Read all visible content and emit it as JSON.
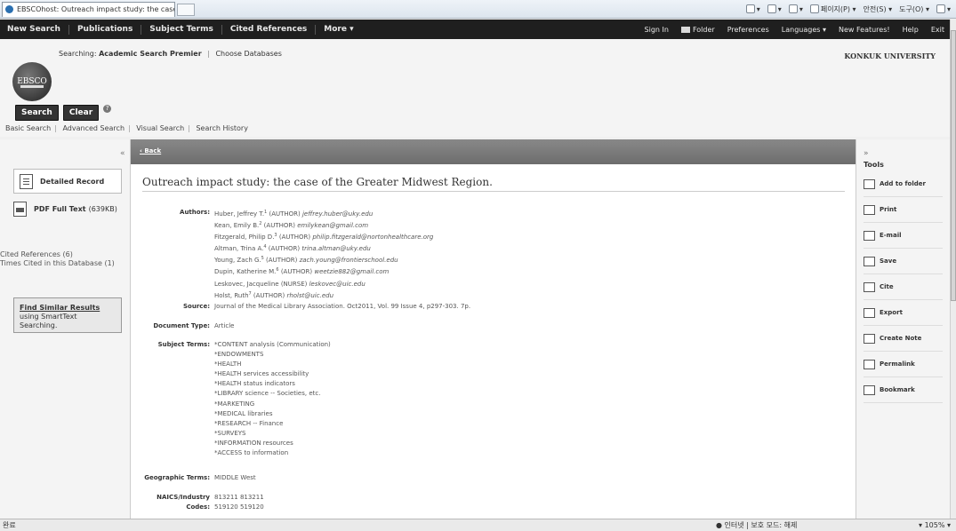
{
  "browser": {
    "tab_title": "EBSCOhost: Outreach impact study: the case of ...",
    "cmd_items": [
      "▾",
      "▾",
      "▾",
      "페이지(P) ▾",
      "안전(S) ▾",
      "도구(O) ▾",
      "▾"
    ],
    "status_left": "완료",
    "status_zone": "인터넷 | 보호 모드: 해제",
    "status_zoom": "105%"
  },
  "topnav": {
    "left": [
      "New Search",
      "Publications",
      "Subject Terms",
      "Cited References",
      "More ▾"
    ],
    "signin": "Sign In",
    "folder": "Folder",
    "preferences": "Preferences",
    "languages": "Languages ▾",
    "new_features": "New Features!",
    "help": "Help",
    "exit": "Exit"
  },
  "search": {
    "logo_text": "EBSCO",
    "searching_label": "Searching:",
    "database": "Academic Search Premier",
    "choose_db": "Choose Databases",
    "university": "KONKUK UNIVERSITY",
    "search_btn": "Search",
    "clear_btn": "Clear",
    "help": "?",
    "links": [
      "Basic Search",
      "Advanced Search",
      "Visual Search",
      "Search History"
    ]
  },
  "left": {
    "collapse": "«",
    "detailed_record": "Detailed Record",
    "pdf_label": "PDF Full Text",
    "pdf_size": "(639KB)",
    "cited_refs": "Cited References (6)",
    "times_cited": "Times Cited in this Database (1)",
    "find_similar_title": "Find Similar Results",
    "find_similar_sub": "using SmartText Searching."
  },
  "record": {
    "back": "‹ Back",
    "title": "Outreach impact study: the case of the Greater Midwest Region.",
    "authors_label": "Authors:",
    "authors": [
      {
        "name": "Huber, Jeffrey T.",
        "sup": "1",
        "role": " (AUTHOR) ",
        "email": "jeffrey.huber@uky.edu"
      },
      {
        "name": "Kean, Emily B.",
        "sup": "2",
        "role": " (AUTHOR) ",
        "email": "emilykean@gmail.com"
      },
      {
        "name": "Fitzgerald, Philip D.",
        "sup": "3",
        "role": " (AUTHOR) ",
        "email": "philip.fitzgerald@nortonhealthcare.org"
      },
      {
        "name": "Altman, Trina A.",
        "sup": "4",
        "role": " (AUTHOR) ",
        "email": "trina.altman@uky.edu"
      },
      {
        "name": "Young, Zach G.",
        "sup": "5",
        "role": " (AUTHOR) ",
        "email": "zach.young@frontierschool.edu"
      },
      {
        "name": "Dupin, Katherine M.",
        "sup": "6",
        "role": " (AUTHOR) ",
        "email": "weetzie882@gmail.com"
      },
      {
        "name": "Leskovec, Jacqueline",
        "sup": "",
        "role": " (NURSE) ",
        "email": "leskovec@uic.edu"
      },
      {
        "name": "Holst, Ruth",
        "sup": "7",
        "role": " (AUTHOR) ",
        "email": "rholst@uic.edu"
      }
    ],
    "source_label": "Source:",
    "source": "Journal of the Medical Library Association. Oct2011, Vol. 99 Issue 4, p297-303. 7p.",
    "doctype_label": "Document Type:",
    "doctype": "Article",
    "subject_label": "Subject Terms:",
    "subjects": [
      "*CONTENT analysis (Communication)",
      "*ENDOWMENTS",
      "*HEALTH",
      "*HEALTH services accessibility",
      "*HEALTH status indicators",
      "*LIBRARY science -- Societies, etc.",
      "*MARKETING",
      "*MEDICAL libraries",
      "*RESEARCH -- Finance",
      "*SURVEYS",
      "*INFORMATION resources",
      "*ACCESS to information"
    ],
    "geo_label": "Geographic Terms:",
    "geo": "MIDDLE West",
    "naics_label1": "NAICS/Industry",
    "naics_label2": "Codes:",
    "naics": [
      "813211 813211",
      "519120 519120"
    ]
  },
  "tools": {
    "collapse": "»",
    "title": "Tools",
    "items": [
      "Add to folder",
      "Print",
      "E-mail",
      "Save",
      "Cite",
      "Export",
      "Create Note",
      "Permalink",
      "Bookmark"
    ]
  }
}
